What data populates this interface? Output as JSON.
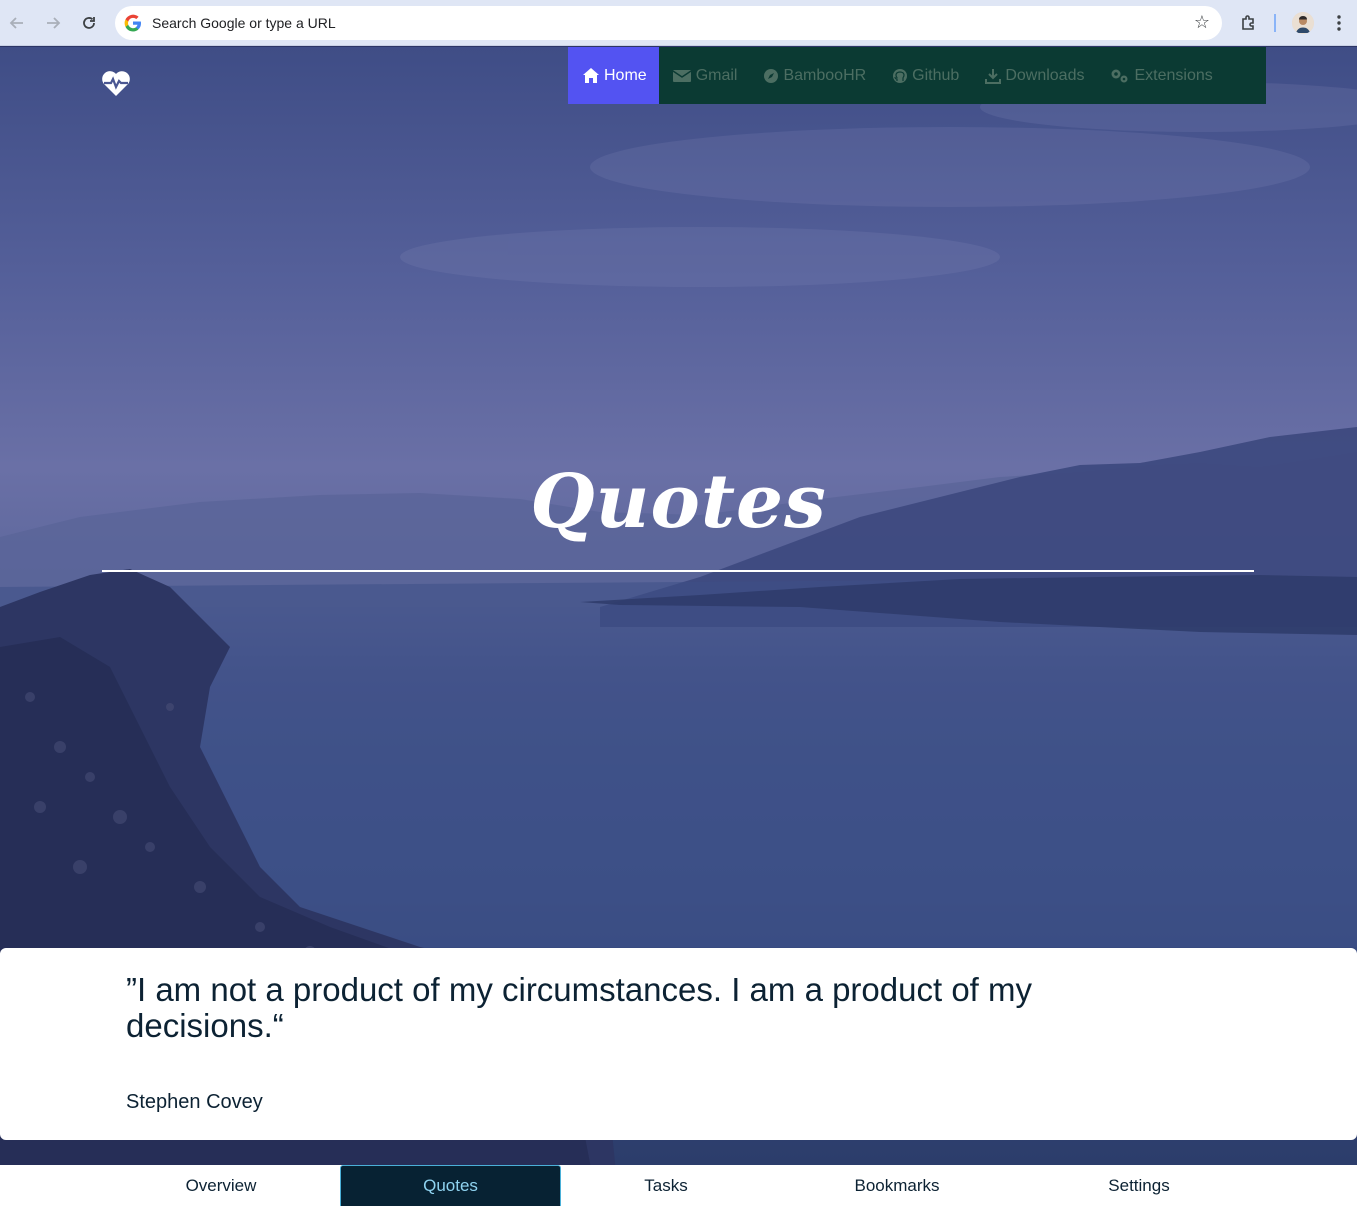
{
  "browser": {
    "omnibox_placeholder": "Search Google or type a URL",
    "icons": [
      "back-icon",
      "forward-icon",
      "reload-icon",
      "google-logo",
      "star-icon",
      "extensions-icon",
      "profile-avatar",
      "kebab-menu-icon"
    ]
  },
  "topnav": {
    "items": [
      {
        "label": "Home",
        "icon": "home-icon",
        "active": true
      },
      {
        "label": "Gmail",
        "icon": "mail-icon",
        "active": false
      },
      {
        "label": "BambooHR",
        "icon": "compass-icon",
        "active": false
      },
      {
        "label": "Github",
        "icon": "github-icon",
        "active": false
      },
      {
        "label": "Downloads",
        "icon": "download-icon",
        "active": false
      },
      {
        "label": "Extensions",
        "icon": "gears-icon",
        "active": false
      }
    ]
  },
  "hero": {
    "title": "Quotes",
    "logo_icon": "heartbeat-icon"
  },
  "quote": {
    "text": "”I am not a product of my circumstances. I am a product of my decisions.“",
    "author": "Stephen Covey"
  },
  "bottom_tabs": {
    "items": [
      {
        "label": "Overview",
        "active": false
      },
      {
        "label": "Quotes",
        "active": true
      },
      {
        "label": "Tasks",
        "active": false
      },
      {
        "label": "Bookmarks",
        "active": false
      },
      {
        "label": "Settings",
        "active": false
      }
    ]
  },
  "colors": {
    "nav_background": "#0b3a33",
    "nav_active": "#5353f2",
    "tab_active": "#072233",
    "text_dark": "#0c2233"
  }
}
